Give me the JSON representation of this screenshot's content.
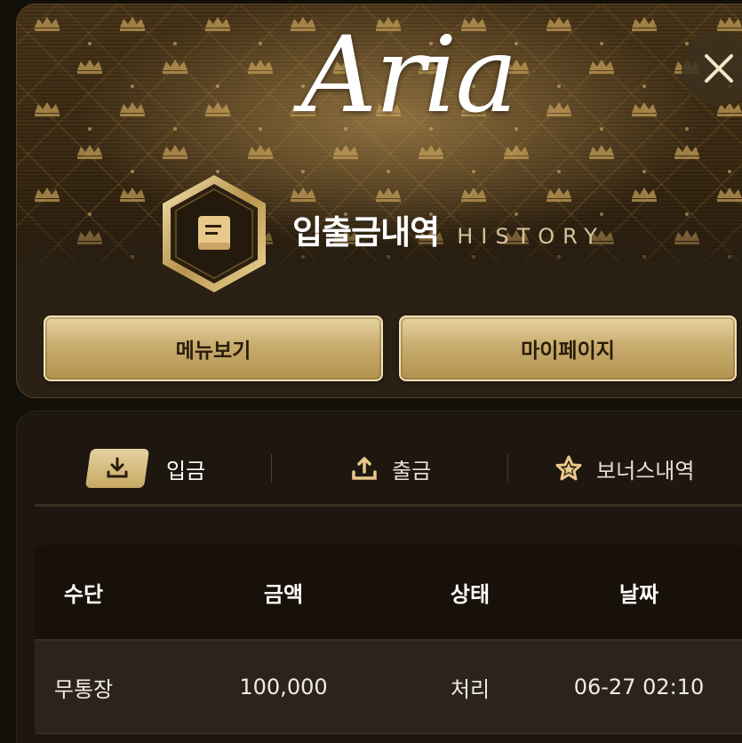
{
  "header": {
    "logo_text": "Aria",
    "title_ko": "입출금내역",
    "title_en": "HISTORY",
    "close_icon": "close-icon",
    "badge_icon": "book-icon",
    "accent_color": "#c9ad6f"
  },
  "buttons": {
    "menu_label": "메뉴보기",
    "mypage_label": "마이페이지"
  },
  "tabs": [
    {
      "label": "입금",
      "icon": "download-icon",
      "active": true
    },
    {
      "label": "출금",
      "icon": "upload-icon",
      "active": false
    },
    {
      "label": "보너스내역",
      "icon": "star-icon",
      "active": false
    }
  ],
  "table": {
    "headers": [
      "수단",
      "금액",
      "상태",
      "날짜"
    ],
    "rows": [
      {
        "method": "무통장",
        "amount": "100,000",
        "status": "처리",
        "date": "06-27 02:10"
      }
    ]
  }
}
